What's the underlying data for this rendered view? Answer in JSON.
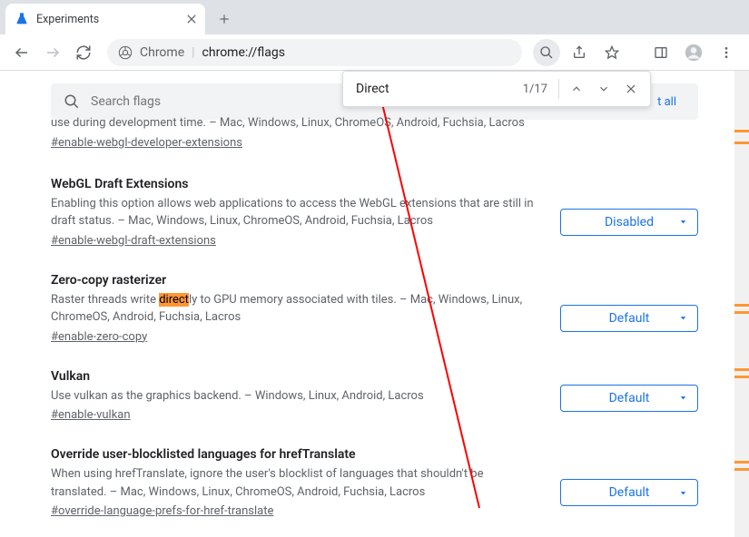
{
  "window": {
    "title": "Experiments"
  },
  "omnibox": {
    "prefix": "Chrome",
    "separator": "|",
    "url": "chrome://flags"
  },
  "search": {
    "placeholder": "Search flags",
    "reset": "t all"
  },
  "find": {
    "query": "Direct",
    "count": "1/17"
  },
  "flags": [
    {
      "title": "",
      "desc_suffix": "use during development time. – Mac, Windows, Linux, ChromeOS, Android, Fuchsia, Lacros",
      "link": "#enable-webgl-developer-extensions",
      "value": ""
    },
    {
      "title": "WebGL Draft Extensions",
      "desc": "Enabling this option allows web applications to access the WebGL extensions that are still in draft status. – Mac, Windows, Linux, ChromeOS, Android, Fuchsia, Lacros",
      "link": "#enable-webgl-draft-extensions",
      "value": "Disabled"
    },
    {
      "title": "Zero-copy rasterizer",
      "desc_pre": "Raster threads write ",
      "desc_hl": "direct",
      "desc_post": "ly to GPU memory associated with tiles. – Mac, Windows, Linux, ChromeOS, Android, Fuchsia, Lacros",
      "link": "#enable-zero-copy",
      "value": "Default"
    },
    {
      "title": "Vulkan",
      "desc": "Use vulkan as the graphics backend. – Windows, Linux, Android, Lacros",
      "link": "#enable-vulkan",
      "value": "Default"
    },
    {
      "title": "Override user-blocklisted languages for hrefTranslate",
      "desc": "When using hrefTranslate, ignore the user's blocklist of languages that shouldn't be translated. – Mac, Windows, Linux, ChromeOS, Android, Fuchsia, Lacros",
      "link": "#override-language-prefs-for-href-translate",
      "value": "Default"
    }
  ]
}
